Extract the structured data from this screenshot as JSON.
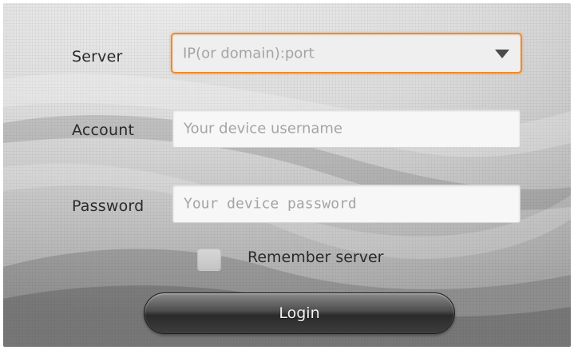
{
  "form": {
    "server": {
      "label": "Server",
      "placeholder": "IP(or domain):port",
      "focused": true
    },
    "account": {
      "label": "Account",
      "placeholder": "Your device username"
    },
    "password": {
      "label": "Password",
      "placeholder": "Your device password"
    },
    "remember": {
      "label": "Remember server",
      "checked": false
    },
    "login_label": "Login"
  },
  "colors": {
    "focus_border": "#f08a2c",
    "button_dark": "#2a2a2a"
  },
  "icons": {
    "dropdown": "triangle-down"
  }
}
